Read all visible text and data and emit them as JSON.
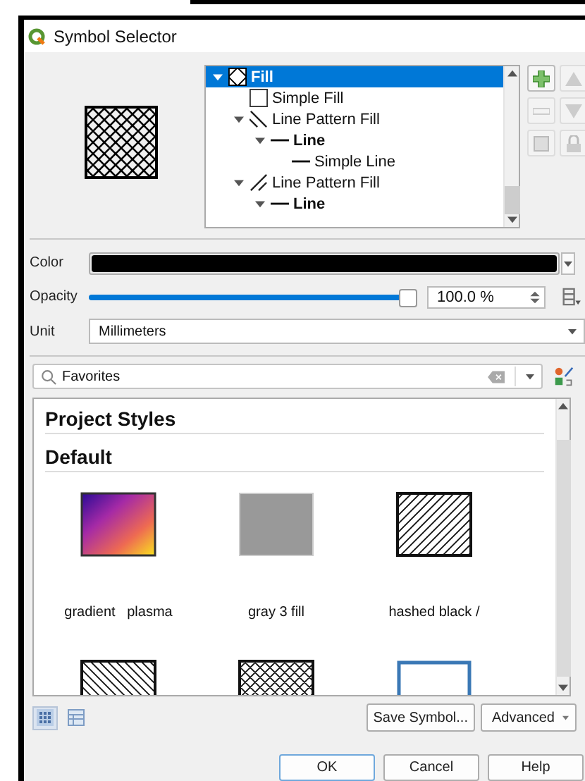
{
  "window": {
    "title": "Symbol Selector"
  },
  "layers": [
    {
      "label": "Fill",
      "kind": "crosshatch",
      "selected": true,
      "expanded": true,
      "children": [
        {
          "label": "Simple Fill",
          "kind": "simple-fill",
          "selected": false
        },
        {
          "label": "Line Pattern Fill",
          "kind": "back-hatch",
          "selected": false,
          "expanded": true,
          "children": [
            {
              "label": "Line",
              "kind": "line",
              "selected": false,
              "expanded": true,
              "children": [
                {
                  "label": "Simple Line",
                  "kind": "simple-line",
                  "selected": false
                }
              ]
            }
          ]
        },
        {
          "label": "Line Pattern Fill",
          "kind": "fwd-hatch",
          "selected": false,
          "expanded": true,
          "children": [
            {
              "label": "Line",
              "kind": "line",
              "selected": false,
              "expanded": true
            }
          ]
        }
      ]
    }
  ],
  "color": {
    "label": "Color",
    "color": "#000000"
  },
  "opacity": {
    "label": "Opacity",
    "level": 1.0,
    "reading": "100.0 %"
  },
  "unit": {
    "label": "Unit",
    "value": "Millimeters"
  },
  "search": {
    "value": "Favorites"
  },
  "library": {
    "sections": [
      "Project Styles",
      "Default"
    ],
    "symbols": [
      {
        "kind": "gradient",
        "name": "gradient   plasma"
      },
      {
        "kind": "gray",
        "name": "gray 3 fill"
      },
      {
        "kind": "fwd-hatch",
        "name": "hashed black /"
      },
      {
        "kind": "back-hatch"
      },
      {
        "kind": "crosshatch"
      },
      {
        "kind": "outline"
      }
    ]
  },
  "view_modes": [
    {
      "kind": "icons",
      "selected": true
    },
    {
      "kind": "list",
      "selected": false
    }
  ],
  "actions": [
    "Save Symbol...",
    "Advanced"
  ],
  "buttons": [
    {
      "label": "OK",
      "default": true
    },
    {
      "label": "Cancel",
      "default": false
    },
    {
      "label": "Help",
      "default": false
    }
  ]
}
